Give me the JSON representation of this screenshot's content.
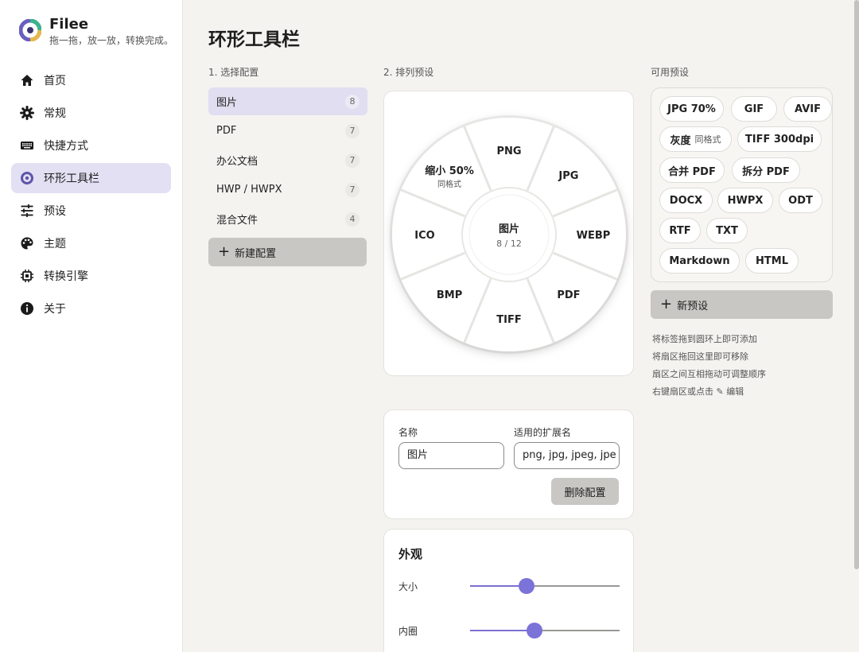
{
  "app": {
    "name": "Filee",
    "tagline": "拖一拖，放一放，转换完成。"
  },
  "sidebar": {
    "items": [
      {
        "label": "首页",
        "icon": "home-icon"
      },
      {
        "label": "常规",
        "icon": "gear-icon"
      },
      {
        "label": "快捷方式",
        "icon": "keyboard-icon"
      },
      {
        "label": "环形工具栏",
        "icon": "ring-icon",
        "active": true
      },
      {
        "label": "预设",
        "icon": "sliders-icon"
      },
      {
        "label": "主题",
        "icon": "palette-icon"
      },
      {
        "label": "转换引擎",
        "icon": "chip-icon"
      },
      {
        "label": "关于",
        "icon": "info-icon"
      }
    ]
  },
  "page": {
    "title": "环形工具栏"
  },
  "sections": {
    "config": "1. 选择配置",
    "arrange": "2. 排列预设",
    "available": "可用预设"
  },
  "configs": [
    {
      "name": "图片",
      "count": "8",
      "active": true
    },
    {
      "name": "PDF",
      "count": "7"
    },
    {
      "name": "办公文档",
      "count": "7"
    },
    {
      "name": "HWP / HWPX",
      "count": "7"
    },
    {
      "name": "混合文件",
      "count": "4"
    }
  ],
  "new_config_label": "新建配置",
  "ring": {
    "center_title": "图片",
    "center_count": "8 / 12",
    "segments": [
      {
        "label": "PNG",
        "sub": ""
      },
      {
        "label": "JPG",
        "sub": ""
      },
      {
        "label": "WEBP",
        "sub": ""
      },
      {
        "label": "PDF",
        "sub": ""
      },
      {
        "label": "TIFF",
        "sub": ""
      },
      {
        "label": "BMP",
        "sub": ""
      },
      {
        "label": "ICO",
        "sub": ""
      },
      {
        "label": "缩小 50%",
        "sub": "同格式"
      }
    ]
  },
  "form": {
    "name_label": "名称",
    "name_value": "图片",
    "ext_label": "适用的扩展名",
    "ext_value": "png, jpg, jpeg, jpe",
    "delete_label": "删除配置"
  },
  "appearance": {
    "title": "外观",
    "size_label": "大小",
    "size_value": 0.38,
    "inner_label": "内圈",
    "inner_value": 0.43,
    "accent": "#7b73d8"
  },
  "presets": [
    {
      "label": "JPG 70%",
      "sub": ""
    },
    {
      "label": "GIF",
      "sub": ""
    },
    {
      "label": "AVIF",
      "sub": ""
    },
    {
      "label": "灰度",
      "sub": "同格式"
    },
    {
      "label": "TIFF 300dpi",
      "sub": ""
    },
    {
      "label": "合并 PDF",
      "sub": ""
    },
    {
      "label": "拆分 PDF",
      "sub": ""
    },
    {
      "label": "DOCX",
      "sub": ""
    },
    {
      "label": "HWPX",
      "sub": ""
    },
    {
      "label": "ODT",
      "sub": ""
    },
    {
      "label": "RTF",
      "sub": ""
    },
    {
      "label": "TXT",
      "sub": ""
    },
    {
      "label": "Markdown",
      "sub": ""
    },
    {
      "label": "HTML",
      "sub": ""
    }
  ],
  "new_preset_label": "新预设",
  "hints": [
    "将标签拖到圆环上即可添加",
    "将扇区拖回这里即可移除",
    "扇区之间互相拖动可调整顺序",
    "右键扇区或点击 ✎ 编辑"
  ]
}
